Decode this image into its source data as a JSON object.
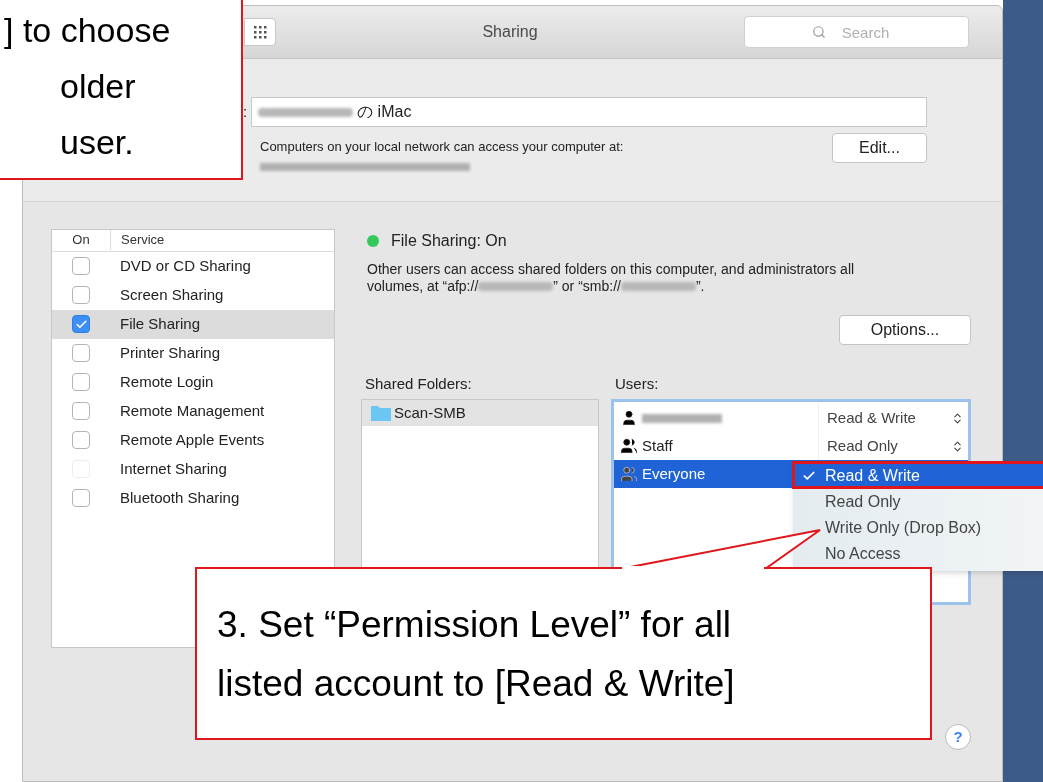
{
  "window": {
    "title": "Sharing",
    "search": {
      "placeholder": "Search"
    }
  },
  "computer_name": {
    "label": ":",
    "value": "の iMac",
    "info": "Computers on your local network can access your computer at:",
    "edit_button": "Edit..."
  },
  "services": {
    "columns": [
      "On",
      "Service"
    ],
    "items": [
      {
        "name": "DVD or CD Sharing",
        "checked": false,
        "disabled": false,
        "selected": false
      },
      {
        "name": "Screen Sharing",
        "checked": false,
        "disabled": false,
        "selected": false
      },
      {
        "name": "File Sharing",
        "checked": true,
        "disabled": false,
        "selected": true
      },
      {
        "name": "Printer Sharing",
        "checked": false,
        "disabled": false,
        "selected": false
      },
      {
        "name": "Remote Login",
        "checked": false,
        "disabled": false,
        "selected": false
      },
      {
        "name": "Remote Management",
        "checked": false,
        "disabled": false,
        "selected": false
      },
      {
        "name": "Remote Apple Events",
        "checked": false,
        "disabled": false,
        "selected": false
      },
      {
        "name": "Internet Sharing",
        "checked": false,
        "disabled": true,
        "selected": false
      },
      {
        "name": "Bluetooth Sharing",
        "checked": false,
        "disabled": false,
        "selected": false
      }
    ]
  },
  "status": {
    "text": "File Sharing: On",
    "color": "#34c759"
  },
  "description_parts": [
    "Other users can access shared folders on this computer, and administrators all volumes, at “afp://",
    "” or “smb://",
    "”."
  ],
  "options_button": "Options...",
  "shared_folders": {
    "label": "Shared Folders:",
    "items": [
      {
        "name": "Scan-SMB",
        "selected": true
      }
    ]
  },
  "users": {
    "label": "Users:",
    "items": [
      {
        "kind": "person",
        "permission": "Read & Write",
        "selected": false
      },
      {
        "kind": "group",
        "name": "Staff",
        "permission": "Read Only",
        "selected": false
      },
      {
        "kind": "everyone",
        "name": "Everyone",
        "selected": true
      }
    ]
  },
  "permission_menu": {
    "framed": true,
    "items": [
      {
        "label": "Read & Write",
        "selected": true
      },
      {
        "label": "Read Only",
        "selected": false
      },
      {
        "label": "Write Only (Drop Box)",
        "selected": false
      },
      {
        "label": "No Access",
        "selected": false
      }
    ]
  },
  "help_button": "?",
  "callouts": [
    {
      "lines": [
        "] to choose",
        "older",
        "user."
      ]
    },
    {
      "lines": [
        "3. Set “Permission Level” for all",
        "listed account to [Read & Write]"
      ]
    }
  ]
}
